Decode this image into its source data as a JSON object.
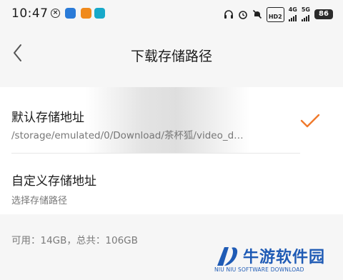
{
  "status_bar": {
    "time": "10:47",
    "notification_icons": [
      "circle-x-icon",
      "app-icon-blue",
      "app-icon-orange",
      "app-icon-teal"
    ],
    "right_icons": [
      "headphones-icon",
      "alarm-icon",
      "mute-icon",
      "hd-icon",
      "signal-4g-icon",
      "signal-5g-icon",
      "battery-icon"
    ],
    "hd_label": "HD2",
    "net1_label": "4G",
    "net2_label": "5G",
    "battery_level": "86"
  },
  "header": {
    "back_icon": "chevron-left-icon",
    "title": "下载存储路径"
  },
  "options": [
    {
      "title": "默认存储地址",
      "subtitle": "/storage/emulated/0/Download/茶杯狐/video_d…",
      "selected": true
    },
    {
      "title": "自定义存储地址",
      "subtitle": "选择存储路径",
      "selected": false
    }
  ],
  "storage_info": "可用：14GB，总共：106GB",
  "colors": {
    "accent": "#f07a2c",
    "background": "#f6f6f6",
    "card": "#ffffff",
    "watermark": "#1f5bb5"
  },
  "watermark": {
    "brand": "牛游软件园",
    "tagline": "NIU NIU SOFTWARE DOWNLOAD"
  }
}
